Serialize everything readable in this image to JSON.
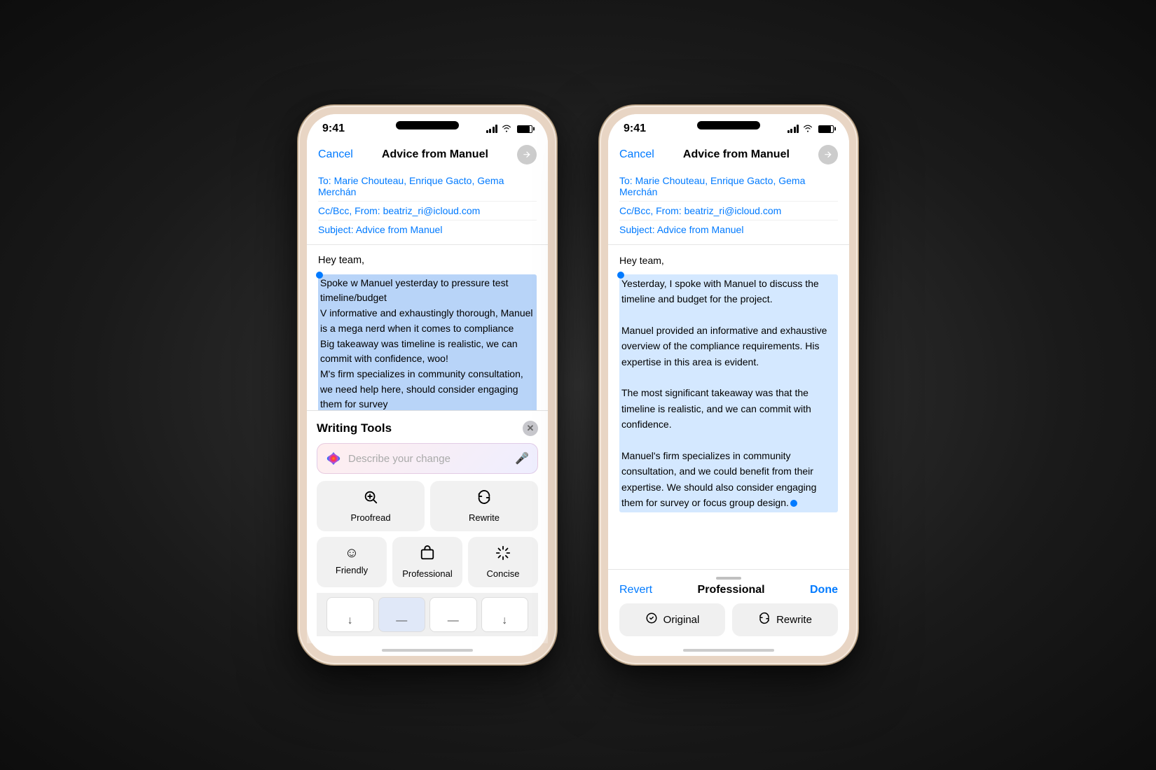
{
  "background": "#1e1e1e",
  "phone1": {
    "status_time": "9:41",
    "mail": {
      "cancel": "Cancel",
      "title": "Advice from Manuel",
      "to_label": "To:",
      "to_recipients": "Marie Chouteau, Enrique Gacto, Gema Merchán",
      "cc_label": "Cc/Bcc, From:",
      "cc_value": "beatriz_ri@icloud.com",
      "subject_label": "Subject:",
      "subject_value": "Advice from Manuel",
      "greeting": "Hey team,",
      "body_selected": "Spoke w Manuel yesterday to pressure test timeline/budget\nV informative and exhaustingly thorough, Manuel is a mega nerd when it comes to compliance\nBig takeaway was timeline is realistic, we can commit with confidence, woo!\nM's firm specializes in community consultation, we need help here, should consider engaging them for survey or focus group design"
    },
    "writing_tools": {
      "title": "Writing Tools",
      "placeholder": "Describe your change",
      "proofread_label": "Proofread",
      "rewrite_label": "Rewrite",
      "friendly_label": "Friendly",
      "professional_label": "Professional",
      "concise_label": "Concise"
    }
  },
  "phone2": {
    "status_time": "9:41",
    "mail": {
      "cancel": "Cancel",
      "title": "Advice from Manuel",
      "to_label": "To:",
      "to_recipients": "Marie Chouteau, Enrique Gacto, Gema Merchán",
      "cc_label": "Cc/Bcc, From:",
      "cc_value": "beatriz_ri@icloud.com",
      "subject_label": "Subject:",
      "subject_value": "Advice from Manuel",
      "greeting": "Hey team,",
      "body_rewritten": "Yesterday, I spoke with Manuel to discuss the timeline and budget for the project.\nManuel provided an informative and exhaustive overview of the compliance requirements. His expertise in this area is evident.\nThe most significant takeaway was that the timeline is realistic, and we can commit with confidence.\nManuel's firm specializes in community consultation, and we could benefit from their expertise. We should also consider engaging them for survey or focus group design."
    },
    "rewrite_footer": {
      "revert_label": "Revert",
      "mode_label": "Professional",
      "done_label": "Done",
      "original_label": "Original",
      "rewrite_label": "Rewrite"
    }
  }
}
